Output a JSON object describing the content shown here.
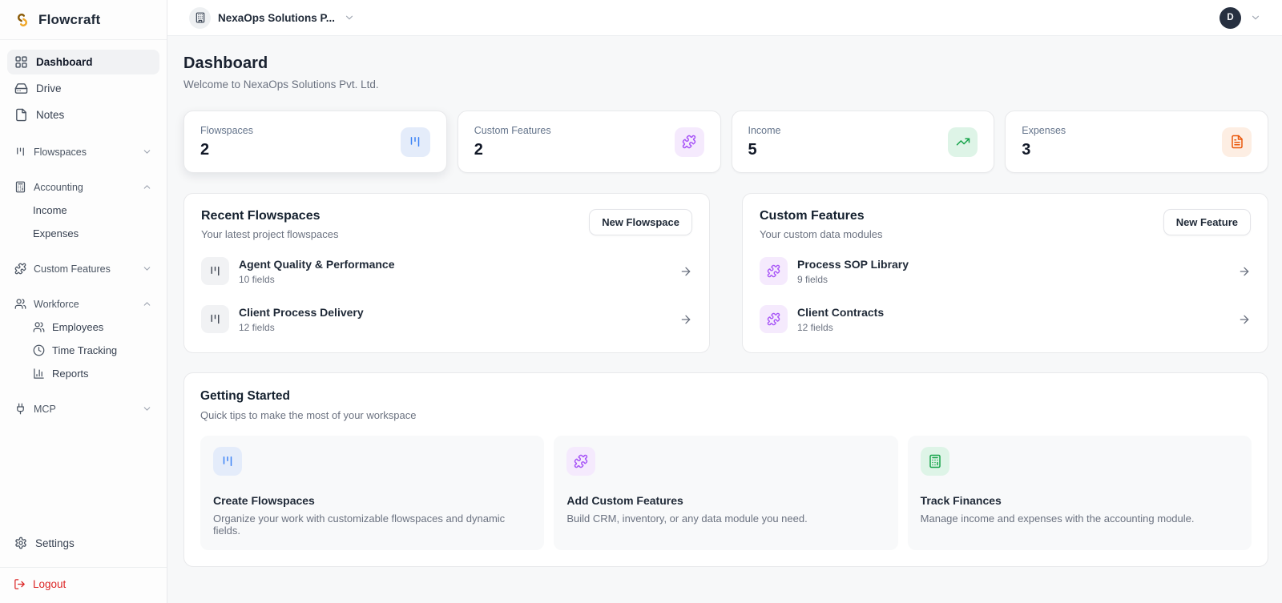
{
  "app": {
    "name": "Flowcraft",
    "logo_icon": "flowcraft-logo"
  },
  "topbar": {
    "org_switcher": {
      "label": "NexaOps Solutions P...",
      "icon": "building"
    },
    "user": {
      "avatar_initial": "D"
    }
  },
  "sidebar": {
    "items": [
      {
        "label": "Dashboard",
        "icon": "layout-grid",
        "active": true
      },
      {
        "label": "Drive",
        "icon": "hard-drive",
        "active": false
      },
      {
        "label": "Notes",
        "icon": "file",
        "active": false
      }
    ],
    "sections": [
      {
        "label": "Flowspaces",
        "icon": "kanban",
        "state": "collapsed"
      },
      {
        "label": "Accounting",
        "icon": "calculator",
        "state": "expanded",
        "children": [
          {
            "label": "Income"
          },
          {
            "label": "Expenses"
          }
        ]
      },
      {
        "label": "Custom Features",
        "icon": "puzzle",
        "state": "collapsed"
      },
      {
        "label": "Workforce",
        "icon": "users",
        "state": "expanded",
        "children": [
          {
            "label": "Employees",
            "icon": "users"
          },
          {
            "label": "Time Tracking",
            "icon": "clock"
          },
          {
            "label": "Reports",
            "icon": "bar-chart"
          }
        ]
      },
      {
        "label": "MCP",
        "icon": "plug",
        "state": "collapsed"
      }
    ],
    "settings_label": "Settings",
    "logout_label": "Logout"
  },
  "page": {
    "title": "Dashboard",
    "subtitle": "Welcome to NexaOps Solutions Pvt. Ltd."
  },
  "stats": [
    {
      "label": "Flowspaces",
      "value": "2",
      "icon": "kanban",
      "accent": "#3b82f6",
      "accent_bg": "#e4ecfa"
    },
    {
      "label": "Custom Features",
      "value": "2",
      "icon": "puzzle",
      "accent": "#a855f7",
      "accent_bg": "#f5eafd"
    },
    {
      "label": "Income",
      "value": "5",
      "icon": "trending-up",
      "accent": "#16a34a",
      "accent_bg": "#def4e7"
    },
    {
      "label": "Expenses",
      "value": "3",
      "icon": "file-text",
      "accent": "#ea580c",
      "accent_bg": "#fdeee3"
    }
  ],
  "recent_flowspaces": {
    "title": "Recent Flowspaces",
    "subtitle": "Your latest project flowspaces",
    "button_label": "New Flowspace",
    "items": [
      {
        "name": "Agent Quality & Performance",
        "meta": "10 fields",
        "icon": "kanban"
      },
      {
        "name": "Client Process Delivery",
        "meta": "12 fields",
        "icon": "kanban"
      }
    ]
  },
  "custom_features": {
    "title": "Custom Features",
    "subtitle": "Your custom data modules",
    "button_label": "New Feature",
    "items": [
      {
        "name": "Process SOP Library",
        "meta": "9 fields",
        "icon": "puzzle"
      },
      {
        "name": "Client Contracts",
        "meta": "12 fields",
        "icon": "puzzle"
      }
    ]
  },
  "getting_started": {
    "title": "Getting Started",
    "subtitle": "Quick tips to make the most of your workspace",
    "tips": [
      {
        "title": "Create Flowspaces",
        "description": "Organize your work with customizable flowspaces and dynamic fields.",
        "icon": "kanban",
        "accent": "#3b82f6",
        "accent_bg": "#e4ecfa"
      },
      {
        "title": "Add Custom Features",
        "description": "Build CRM, inventory, or any data module you need.",
        "icon": "puzzle",
        "accent": "#a855f7",
        "accent_bg": "#f5eafd"
      },
      {
        "title": "Track Finances",
        "description": "Manage income and expenses with the accounting module.",
        "icon": "calculator",
        "accent": "#16a34a",
        "accent_bg": "#def4e7"
      }
    ]
  },
  "colors": {
    "logout_red": "#dc2626",
    "avatar_bg": "#273040",
    "brand_amber": "#d97706"
  }
}
